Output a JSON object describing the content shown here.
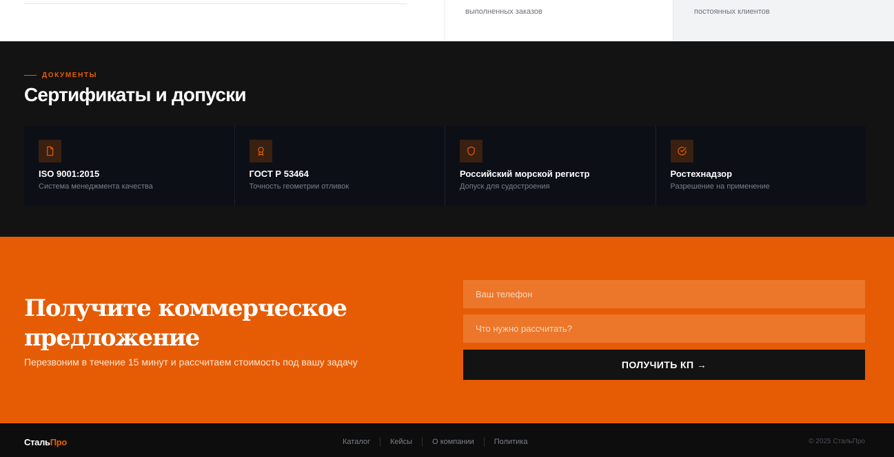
{
  "stats": [
    {
      "label": "выполненных заказов"
    },
    {
      "label": "постоянных клиентов"
    }
  ],
  "certificates": {
    "eyebrow": "ДОКУМЕНТЫ",
    "title": "Сертификаты и допуски",
    "items": [
      {
        "icon": "document-icon",
        "name": "ISO 9001:2015",
        "description": "Система менеджмента качества"
      },
      {
        "icon": "award-icon",
        "name": "ГОСТ Р 53464",
        "description": "Точность геометрии отливок"
      },
      {
        "icon": "shield-icon",
        "name": "Российский морской регистр",
        "description": "Допуск для судостроения"
      },
      {
        "icon": "check-circle-icon",
        "name": "Ростехнадзор",
        "description": "Разрешение на применение"
      }
    ]
  },
  "cta": {
    "title": "Получите коммерческое предложение",
    "subtitle": "Перезвоним в течение 15 минут и рассчитаем стоимость под вашу задачу",
    "phone_placeholder": "Ваш телефон",
    "task_placeholder": "Что нужно рассчитать?",
    "submit_label": "ПОЛУЧИТЬ КП →"
  },
  "footer": {
    "logo_part1": "Сталь",
    "logo_part2": "Про",
    "nav": [
      "Каталог",
      "Кейсы",
      "О компании",
      "Политика"
    ],
    "copyright": "© 2025 СтальПро"
  },
  "colors": {
    "accent": "#e65c04",
    "dark": "#131313",
    "card": "#0c0f16"
  }
}
